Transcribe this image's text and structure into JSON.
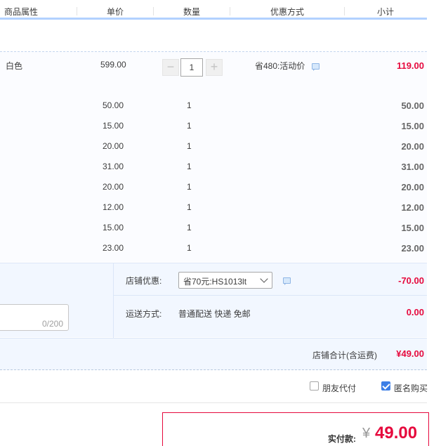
{
  "header": {
    "columns": [
      "商品属性",
      "单价",
      "数量",
      "优惠方式",
      "小计"
    ]
  },
  "first_item": {
    "attribute": "白色",
    "price": "599.00",
    "quantity": "1",
    "minus": "−",
    "plus": "+",
    "discount": "省480:活动价",
    "subtotal": "119.00"
  },
  "items": [
    {
      "price": "50.00",
      "quantity": "1",
      "subtotal": "50.00"
    },
    {
      "price": "15.00",
      "quantity": "1",
      "subtotal": "15.00"
    },
    {
      "price": "20.00",
      "quantity": "1",
      "subtotal": "20.00"
    },
    {
      "price": "31.00",
      "quantity": "1",
      "subtotal": "31.00"
    },
    {
      "price": "20.00",
      "quantity": "1",
      "subtotal": "20.00"
    },
    {
      "price": "12.00",
      "quantity": "1",
      "subtotal": "12.00"
    },
    {
      "price": "15.00",
      "quantity": "1",
      "subtotal": "15.00"
    },
    {
      "price": "23.00",
      "quantity": "1",
      "subtotal": "23.00"
    }
  ],
  "shop": {
    "coupon_label": "店铺优惠:",
    "coupon_value": "省70元:HS1013lt",
    "coupon_amount": "-70.00",
    "shipping_label": "运送方式:",
    "shipping_value": "普通配送 快递 免邮",
    "shipping_amount": "0.00",
    "message_counter": "0/200",
    "total_label": "店铺合计(含运费)",
    "total_amount": "¥49.00"
  },
  "options": {
    "friend_pay": "朋友代付",
    "friend_pay_checked": false,
    "anonymous": "匿名购买",
    "anonymous_checked": true
  },
  "payment": {
    "label": "实付款:",
    "currency": "¥",
    "amount": "49.00"
  },
  "colors": {
    "accent_red": "#e6093d",
    "header_line": "#b2d1ff",
    "checkbox_blue": "#3d7fe6"
  }
}
